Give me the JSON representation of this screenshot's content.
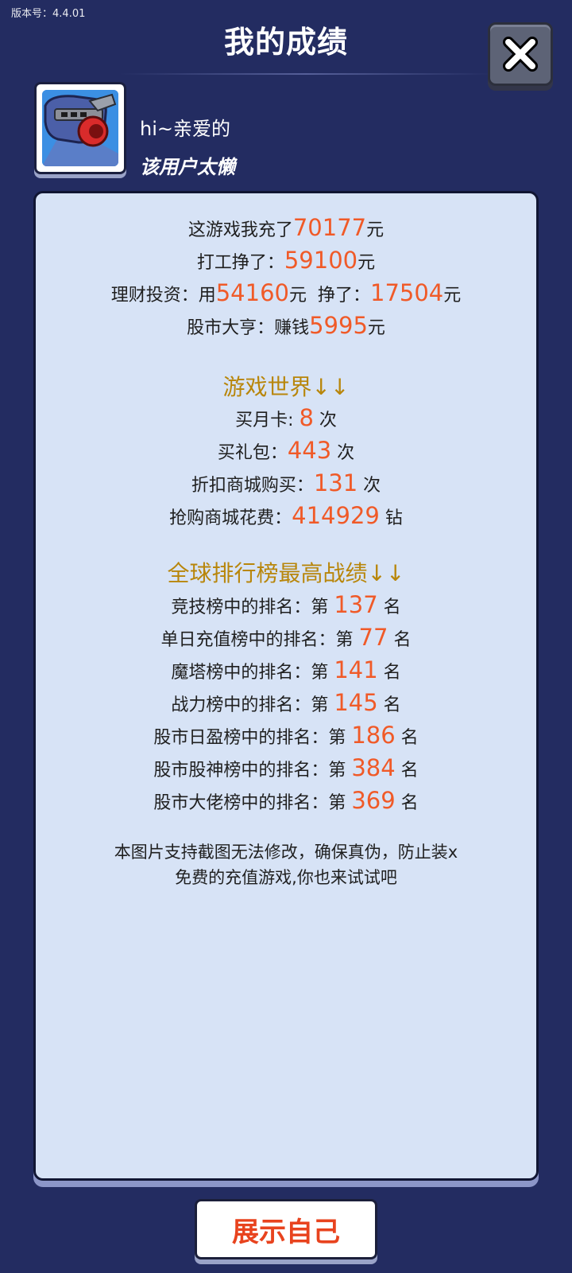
{
  "version": {
    "label": "版本号：",
    "value": "4.4.01"
  },
  "header": {
    "title": "我的成绩"
  },
  "user": {
    "name": "hi~亲爱的",
    "signature": "该用户太懒"
  },
  "recharge": {
    "prefix": "这游戏我充了",
    "amount": "70177",
    "unit": "元"
  },
  "work": {
    "prefix": "打工挣了：",
    "amount": "59100",
    "unit": "元"
  },
  "invest": {
    "prefix": "理财投资：用",
    "spent": "54160",
    "unit1": "元  挣了：",
    "earned": "17504",
    "unit2": "元"
  },
  "stock": {
    "prefix": "股市大亨：赚钱",
    "amount": "5995",
    "unit": "元"
  },
  "game_world": {
    "heading": "游戏世界↓↓",
    "items": [
      {
        "label": "买月卡: ",
        "value": "8",
        "unit": " 次"
      },
      {
        "label": "买礼包：",
        "value": "443",
        "unit": " 次"
      },
      {
        "label": "折扣商城购买：",
        "value": "131",
        "unit": " 次"
      },
      {
        "label": "抢购商城花费：",
        "value": "414929",
        "unit": " 钻"
      }
    ]
  },
  "rankings": {
    "heading": "全球排行榜最高战绩↓↓",
    "items": [
      {
        "label": "竞技榜中的排名：第 ",
        "value": "137",
        "unit": " 名"
      },
      {
        "label": "单日充值榜中的排名：第 ",
        "value": "77",
        "unit": " 名"
      },
      {
        "label": "魔塔榜中的排名：第 ",
        "value": "141",
        "unit": " 名"
      },
      {
        "label": "战力榜中的排名：第 ",
        "value": "145",
        "unit": " 名"
      },
      {
        "label": "股市日盈榜中的排名：第 ",
        "value": "186",
        "unit": " 名"
      },
      {
        "label": "股市股神榜中的排名：第 ",
        "value": "384",
        "unit": " 名"
      },
      {
        "label": "股市大佬榜中的排名：第 ",
        "value": "369",
        "unit": " 名"
      }
    ]
  },
  "footnote": {
    "line1": "本图片支持截图无法修改，确保真伪，防止装x",
    "line2": "免费的充值游戏,你也来试试吧"
  },
  "show_button": {
    "label": "展示自己"
  },
  "colors": {
    "background": "#232c61",
    "card": "#d7e3f6",
    "highlight": "#f05a28",
    "section": "#b8860b",
    "button_text": "#e8431e"
  },
  "icons": {
    "close": "close-x-icon",
    "avatar": "robot-avatar-icon"
  }
}
